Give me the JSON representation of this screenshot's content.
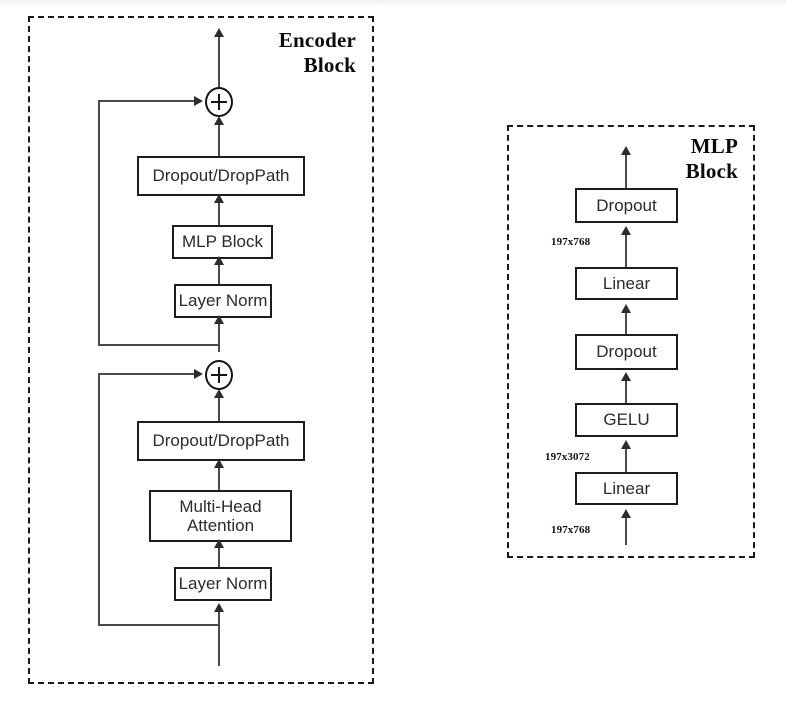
{
  "figure": {
    "kind": "architecture-diagram",
    "background": "#ffffff",
    "line_color": "#4a4a4a",
    "box_border_color": "#1d1d1d",
    "text_color": "#2b2b2b",
    "group_border_style": "dashed"
  },
  "encoder": {
    "title": "Encoder\nBlock",
    "nodes": {
      "dropout_droppath_top": "Dropout/DropPath",
      "mlp_block": "MLP Block",
      "layer_norm_top": "Layer Norm",
      "dropout_droppath_bottom": "Dropout/DropPath",
      "multi_head_attention": "Multi-Head\nAttention",
      "layer_norm_bottom": "Layer Norm"
    },
    "operators": {
      "residual_add_top": "+",
      "residual_add_bottom": "+"
    }
  },
  "mlp": {
    "title": "MLP\nBlock",
    "nodes": {
      "dropout_top": "Dropout",
      "linear_top": "Linear",
      "dropout_bottom": "Dropout",
      "gelu": "GELU",
      "linear_bottom": "Linear"
    },
    "dims": {
      "after_linear_top": "197x768",
      "after_linear_bottom": "197x3072",
      "input": "197x768"
    }
  }
}
